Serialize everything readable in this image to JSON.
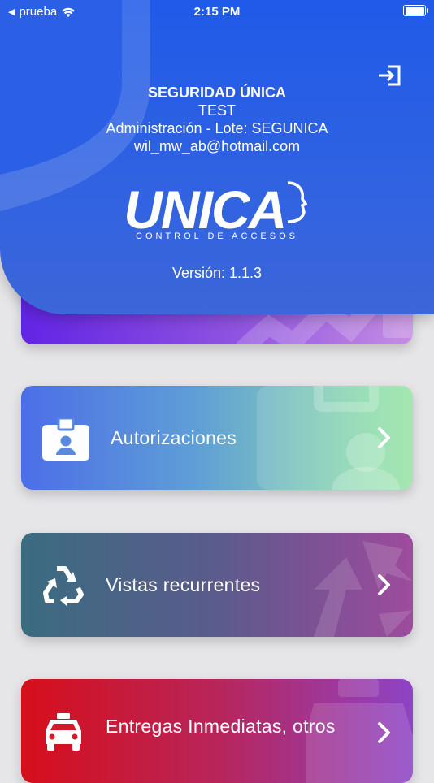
{
  "status_bar": {
    "carrier": "prueba",
    "time": "2:15 PM"
  },
  "header": {
    "company": "SEGURIDAD ÚNICA",
    "name": "TEST",
    "subtitle": "Administración - Lote: SEGUNICA",
    "email": "wil_mw_ab@hotmail.com",
    "logo_text": "UNICA",
    "logo_tagline": "CONTROL DE ACCESOS",
    "version": "Versión: 1.1.3"
  },
  "menu": {
    "items": [
      {
        "label": "",
        "icon": "calendar-icon"
      },
      {
        "label": "Autorizaciones",
        "icon": "badge-icon"
      },
      {
        "label": "Vistas recurrentes",
        "icon": "recycle-icon"
      },
      {
        "label": "Entregas Inmediatas, otros",
        "icon": "taxi-icon"
      }
    ]
  },
  "colors": {
    "header": "#1f5ae8",
    "background": "#e6e6e9"
  }
}
